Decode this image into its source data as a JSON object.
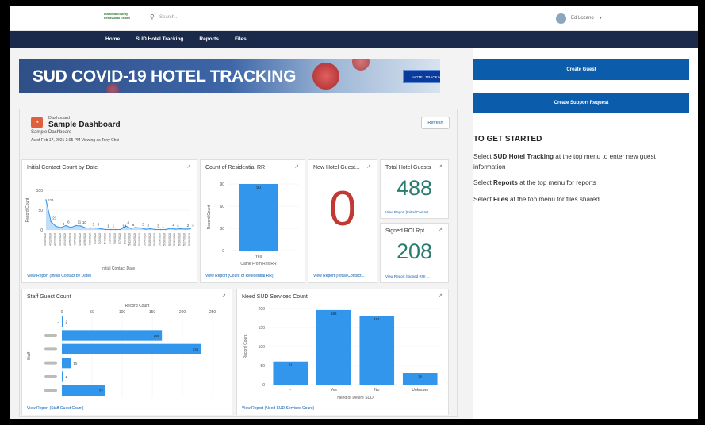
{
  "header": {
    "logo_text": "alameda county behavioral health",
    "search_placeholder": "Search...",
    "user_name": "Ed Lozano"
  },
  "nav": [
    "Home",
    "SUD Hotel Tracking",
    "Reports",
    "Files"
  ],
  "banner": {
    "title": "SUD COVID-19 HOTEL TRACKING",
    "button": "HOTEL TRACKING"
  },
  "right": {
    "create_guest": "Create Guest",
    "create_support": "Create Support Request",
    "get_started": "TO GET STARTED",
    "line1_pre": "Select ",
    "line1_bold": "SUD Hotel Tracking",
    "line1_post": " at the top menu to enter new guest information",
    "line2_pre": "Select ",
    "line2_bold": "Reports",
    "line2_post": " at the top menu for reports",
    "line3_pre": "Select ",
    "line3_bold": "Files",
    "line3_post": " at the top menu for files shared"
  },
  "dashboard": {
    "label": "Dashboard",
    "title": "Sample Dashboard",
    "subtitle": "Sample Dashboard",
    "as_of": "As of Feb 17, 2021 3:05 PM Viewing as Tony Choi",
    "refresh": "Refresh"
  },
  "cards": {
    "initial": {
      "title": "Initial Contact Count by Date",
      "link": "View Report (Initial Contact by Date)"
    },
    "residential": {
      "title": "Count of Residential RR",
      "link": "View Report (Count of Residential RR)"
    },
    "newguest": {
      "title": "New Hotel Guest...",
      "value": "0",
      "link": "View Report (Initial Contact..."
    },
    "totalguests": {
      "title": "Total Hotel Guests",
      "value": "488",
      "link": "View Report (Initial Contact..."
    },
    "signedroi": {
      "title": "Signed ROI Rpt",
      "value": "208",
      "link": "View Report (Signed ROI ..."
    },
    "staff": {
      "title": "Staff Guest Count",
      "link": "View Report (Staff Guest Count)"
    },
    "needsud": {
      "title": "Need SUD Services Count",
      "link": "View Report (Need SUD Services Count)"
    }
  },
  "colors": {
    "accent": "#0b5cab",
    "bar": "#3296ed",
    "nav": "#1b2a4a",
    "metric": "#2a7c6f",
    "zero": "#c23934"
  },
  "chart_data": [
    {
      "type": "area",
      "title": "Initial Contact Count by Date",
      "xlabel": "Initial Contact Date",
      "ylabel": "Record Count",
      "ylim": [
        0,
        100
      ],
      "x": [
        "4/20/2020",
        "4/21/2020",
        "4/22/2020",
        "4/23/2020",
        "4/24/2020",
        "4/25/2020",
        "4/27/2020",
        "4/28/2020",
        "4/29/2020",
        "4/30/2020",
        "5/1/2020",
        "5/2/2020",
        "5/4/2020",
        "5/5/2020",
        "5/6/2020",
        "5/7/2020",
        "5/8/2020",
        "5/11/2020",
        "5/12/2020",
        "5/13/2020",
        "5/14/2020",
        "5/15/2020",
        "5/18/2020",
        "5/19/2020",
        "5/20/2020",
        "5/21/2020",
        "5/22/2020",
        "5/26/2020",
        "5/27/2020",
        "5/28/2020"
      ],
      "values": [
        76,
        21,
        9,
        6,
        11,
        6,
        11,
        10,
        5,
        5,
        5,
        3,
        1,
        1,
        1,
        1,
        10,
        4,
        6,
        5,
        2,
        3,
        1,
        1,
        1,
        4,
        2,
        3,
        2,
        3
      ],
      "labels": [
        "126",
        "21",
        "9",
        "6",
        "11",
        "10",
        "5",
        "5",
        "1",
        "1",
        "10",
        "4",
        "6",
        "5",
        "2",
        "3",
        "1",
        "1",
        "4",
        "2",
        "3"
      ],
      "yticks": [
        "100",
        "50",
        "0"
      ]
    },
    {
      "type": "bar",
      "title": "Count of Residential RR",
      "categories": [
        "Yes"
      ],
      "values": [
        90
      ],
      "xlabel": "Came From Res/RR",
      "ylabel": "Record Count",
      "ylim": [
        0,
        90
      ],
      "yticks": [
        "90",
        "60",
        "30",
        "0"
      ]
    },
    {
      "type": "bar",
      "orientation": "horizontal",
      "title": "Staff Guest Count",
      "xlabel": "Record Count",
      "ylabel": "Staff",
      "categories": [
        "-",
        "",
        "",
        "",
        "",
        ""
      ],
      "values": [
        2,
        166,
        231,
        15,
        2,
        72
      ],
      "xticks": [
        "0",
        "50",
        "100",
        "150",
        "200",
        "250"
      ],
      "xlim": [
        0,
        250
      ]
    },
    {
      "type": "bar",
      "title": "Need SUD Services Count",
      "categories": [
        "-",
        "Yes",
        "No",
        "Unknown"
      ],
      "values": [
        61,
        196,
        181,
        30
      ],
      "xlabel": "Need or Desire SUD",
      "ylabel": "Record Count",
      "ylim": [
        0,
        200
      ],
      "yticks": [
        "200",
        "150",
        "100",
        "50",
        "0"
      ]
    }
  ]
}
